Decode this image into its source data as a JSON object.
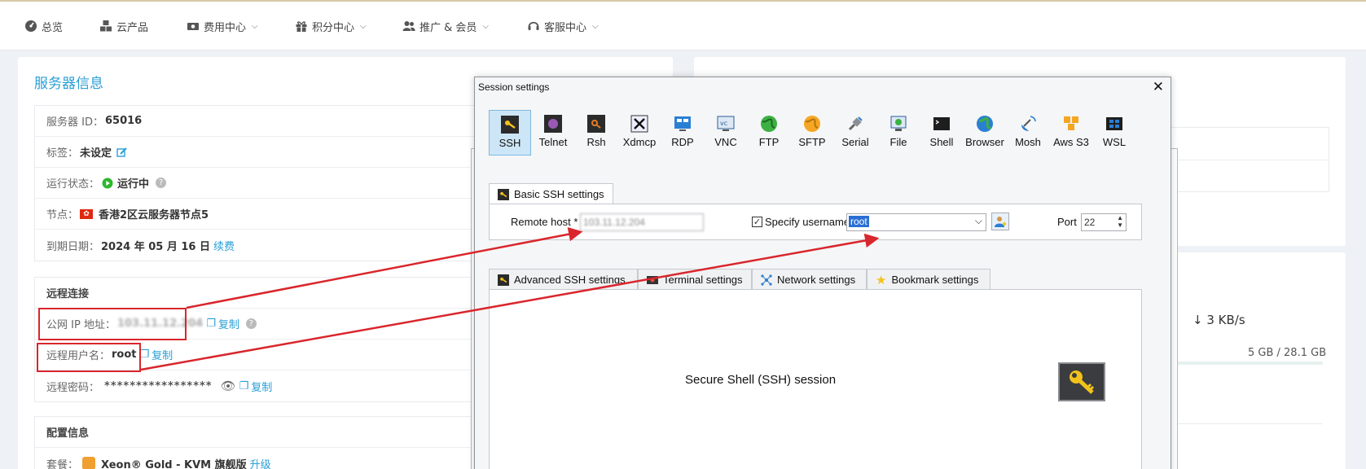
{
  "nav": [
    {
      "label": "总览",
      "icon": "dashboard-icon",
      "chevron": false
    },
    {
      "label": "云产品",
      "icon": "cubes-icon",
      "chevron": false
    },
    {
      "label": "费用中心",
      "icon": "money-icon",
      "chevron": true
    },
    {
      "label": "积分中心",
      "icon": "gift-icon",
      "chevron": true
    },
    {
      "label": "推广 & 会员",
      "icon": "users-icon",
      "chevron": true
    },
    {
      "label": "客服中心",
      "icon": "headset-icon",
      "chevron": true
    }
  ],
  "server": {
    "title": "服务器信息",
    "id_label": "服务器 ID：",
    "id_value": "65016",
    "tag_label": "标签：",
    "tag_value": "未设定",
    "status_label": "运行状态：",
    "status_value": "运行中",
    "node_label": "节点：",
    "node_value": "香港2区云服务器节点5",
    "expire_label": "到期日期：",
    "expire_value": "2024 年 05 月 16 日",
    "renew": "续费"
  },
  "remote": {
    "heading": "远程连接",
    "ip_label": "公网 IP 地址：",
    "ip_value": "103.11.12.204",
    "copy": "复制",
    "user_label": "远程用户名：",
    "user_value": "root",
    "pass_label": "远程密码：",
    "pass_value": "*****************"
  },
  "config": {
    "heading": "配置信息",
    "plan_label": "套餐：",
    "plan_value": "Xeon® Gold - KVM 旗舰版",
    "upgrade": "升级"
  },
  "right": {
    "speed": "↓ 3 KB/s",
    "usage": "5 GB / 28.1 GB"
  },
  "dialog": {
    "title": "Session settings",
    "protocols": [
      "SSH",
      "Telnet",
      "Rsh",
      "Xdmcp",
      "RDP",
      "VNC",
      "FTP",
      "SFTP",
      "Serial",
      "File",
      "Shell",
      "Browser",
      "Mosh",
      "Aws S3",
      "WSL"
    ],
    "basic_tab": "Basic SSH settings",
    "remote_host_label": "Remote host *",
    "remote_host_value": "103.11.12.204",
    "specify_username_label": "Specify username",
    "username_value": "root",
    "port_label": "Port",
    "port_value": "22",
    "tabs": [
      "Advanced SSH settings",
      "Terminal settings",
      "Network settings",
      "Bookmark settings"
    ],
    "session_desc": "Secure Shell (SSH) session"
  },
  "colors": {
    "accent": "#2a9fd6",
    "annotation_red": "#d9262c",
    "status_green": "#2eb82e"
  }
}
